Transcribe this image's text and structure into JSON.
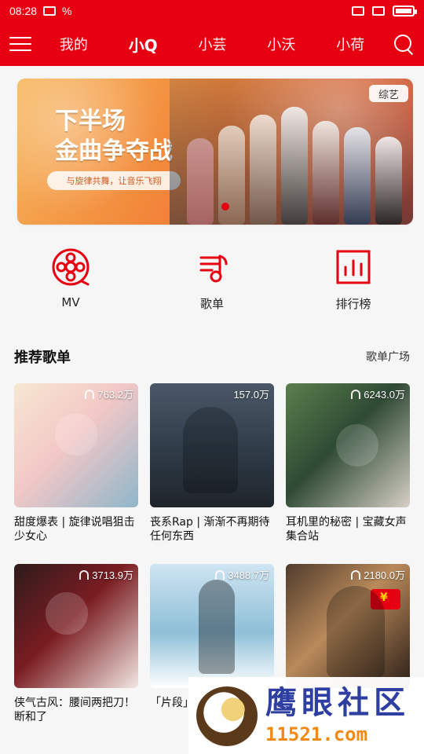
{
  "status_bar": {
    "time": "08:28",
    "extra": "%"
  },
  "topnav": {
    "tabs": [
      {
        "label": "我的",
        "active": false
      },
      {
        "label": "小Q",
        "active": true
      },
      {
        "label": "小芸",
        "active": false
      },
      {
        "label": "小沃",
        "active": false
      },
      {
        "label": "小荷",
        "active": false
      }
    ]
  },
  "banner": {
    "headline_line1": "下半场",
    "headline_line2": "金曲争夺战",
    "subline": "与旋律共舞，让音乐飞翔",
    "tag": "综艺"
  },
  "quick_actions": [
    {
      "label": "MV",
      "icon": "film-reel-icon"
    },
    {
      "label": "歌单",
      "icon": "playlist-icon"
    },
    {
      "label": "排行榜",
      "icon": "chart-icon"
    }
  ],
  "section": {
    "title": "推荐歌单",
    "link": "歌单广场"
  },
  "playlists": [
    {
      "play_count": "763.2万",
      "title": "甜度爆表 | 旋律说唱狙击少女心"
    },
    {
      "play_count": "157.0万",
      "title": "丧系Rap | 渐渐不再期待任何东西"
    },
    {
      "play_count": "6243.0万",
      "title": "耳机里的秘密 | 宝藏女声集合站"
    },
    {
      "play_count": "3713.9万",
      "title": "侠气古风：腰间两把刀！断和了"
    },
    {
      "play_count": "3488.7万",
      "title": "「片段」"
    },
    {
      "play_count": "2180.0万",
      "title": ""
    }
  ],
  "watermark": {
    "top": "鹰眼社区",
    "bottom": "11521.com"
  },
  "colors": {
    "brand_red": "#e60012"
  }
}
